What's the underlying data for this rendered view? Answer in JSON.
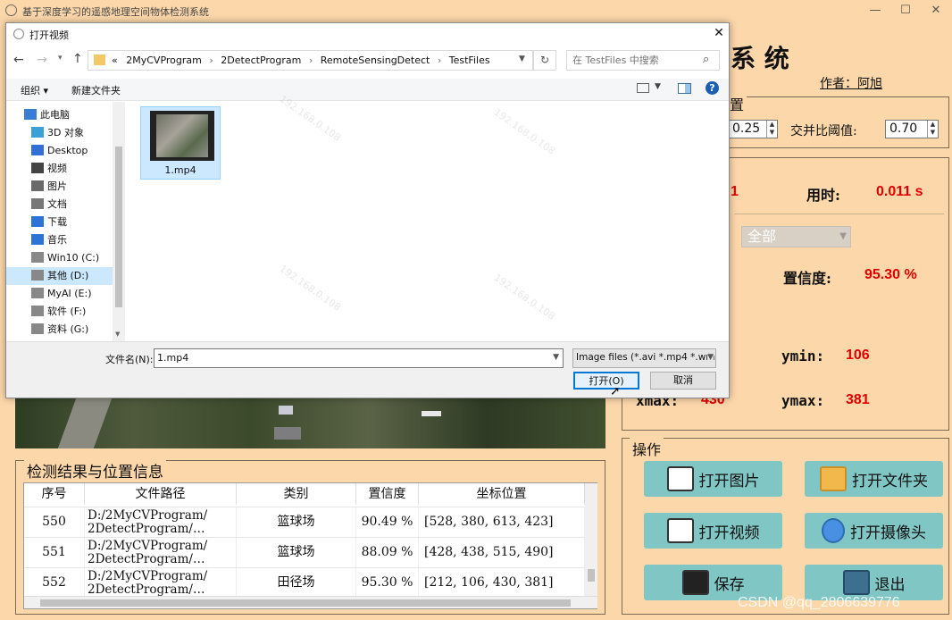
{
  "window": {
    "title": "基于深度学习的遥感地理空间物体检测系统",
    "controls": [
      "—",
      "☐",
      "✕"
    ]
  },
  "header": {
    "title_visible": "系 统",
    "author": "作者：阿旭"
  },
  "params": {
    "legend": "置",
    "conf_value": "0.25",
    "iou_label": "交并比阈值:",
    "iou_value": "0.70"
  },
  "results": {
    "count_value": "1",
    "time_label": "用时:",
    "time_value": "0.011 s",
    "target_select": "全部",
    "conf_label": "置信度:",
    "conf_value": "95.30 %",
    "ymin_label": "ymin:",
    "ymin_value": "106",
    "xmax_label": "xmax:",
    "xmax_value": "430",
    "ymax_label": "ymax:",
    "ymax_value": "381"
  },
  "ops": {
    "legend": "操作",
    "open_image": "打开图片",
    "open_folder": "打开文件夹",
    "open_video": "打开视频",
    "open_camera": "打开摄像头",
    "save": "保存",
    "exit": "退出"
  },
  "table": {
    "legend": "检测结果与位置信息",
    "headers": [
      "序号",
      "文件路径",
      "类别",
      "置信度",
      "坐标位置"
    ],
    "rows": [
      {
        "id": "550",
        "path1": "D:/2MyCVProgram/",
        "path2": "2DetectProgram/…",
        "cls": "篮球场",
        "conf": "90.49 %",
        "coord": "[528, 380, 613, 423]"
      },
      {
        "id": "551",
        "path1": "D:/2MyCVProgram/",
        "path2": "2DetectProgram/…",
        "cls": "篮球场",
        "conf": "88.09 %",
        "coord": "[428, 438, 515, 490]"
      },
      {
        "id": "552",
        "path1": "D:/2MyCVProgram/",
        "path2": "2DetectProgram/…",
        "cls": "田径场",
        "conf": "95.30 %",
        "coord": "[212, 106, 430, 381]"
      }
    ]
  },
  "dialog": {
    "title": "打开视频",
    "breadcrumb": [
      "«",
      "2MyCVProgram",
      "2DetectProgram",
      "RemoteSensingDetect",
      "TestFiles"
    ],
    "search_placeholder": "在 TestFiles 中搜索",
    "organize": "组织 ▾",
    "new_folder": "新建文件夹",
    "sidebar": [
      {
        "label": "此电脑",
        "icon": "computer-icon"
      },
      {
        "label": "3D 对象",
        "icon": "3d-objects-icon"
      },
      {
        "label": "Desktop",
        "icon": "desktop-icon"
      },
      {
        "label": "视频",
        "icon": "video-folder-icon"
      },
      {
        "label": "图片",
        "icon": "pictures-icon"
      },
      {
        "label": "文档",
        "icon": "documents-icon"
      },
      {
        "label": "下载",
        "icon": "download-icon"
      },
      {
        "label": "音乐",
        "icon": "music-icon"
      },
      {
        "label": "Win10 (C:)",
        "icon": "drive-icon"
      },
      {
        "label": "其他 (D:)",
        "icon": "drive-icon"
      },
      {
        "label": "MyAI (E:)",
        "icon": "drive-icon"
      },
      {
        "label": "软件 (F:)",
        "icon": "drive-icon"
      },
      {
        "label": "资料 (G:)",
        "icon": "drive-icon"
      }
    ],
    "file": {
      "name": "1.mp4"
    },
    "filename_label": "文件名(N):",
    "filename_value": "1.mp4",
    "filetype": "Image files (*.avi *.mp4 *.wm",
    "open_btn": "打开(O)",
    "cancel_btn": "取消"
  },
  "watermark": "CSDN @qq_2806639776",
  "colors": {
    "background": "#fcd7aa",
    "button": "#7fc6c4",
    "accent_red": "#e00000"
  }
}
